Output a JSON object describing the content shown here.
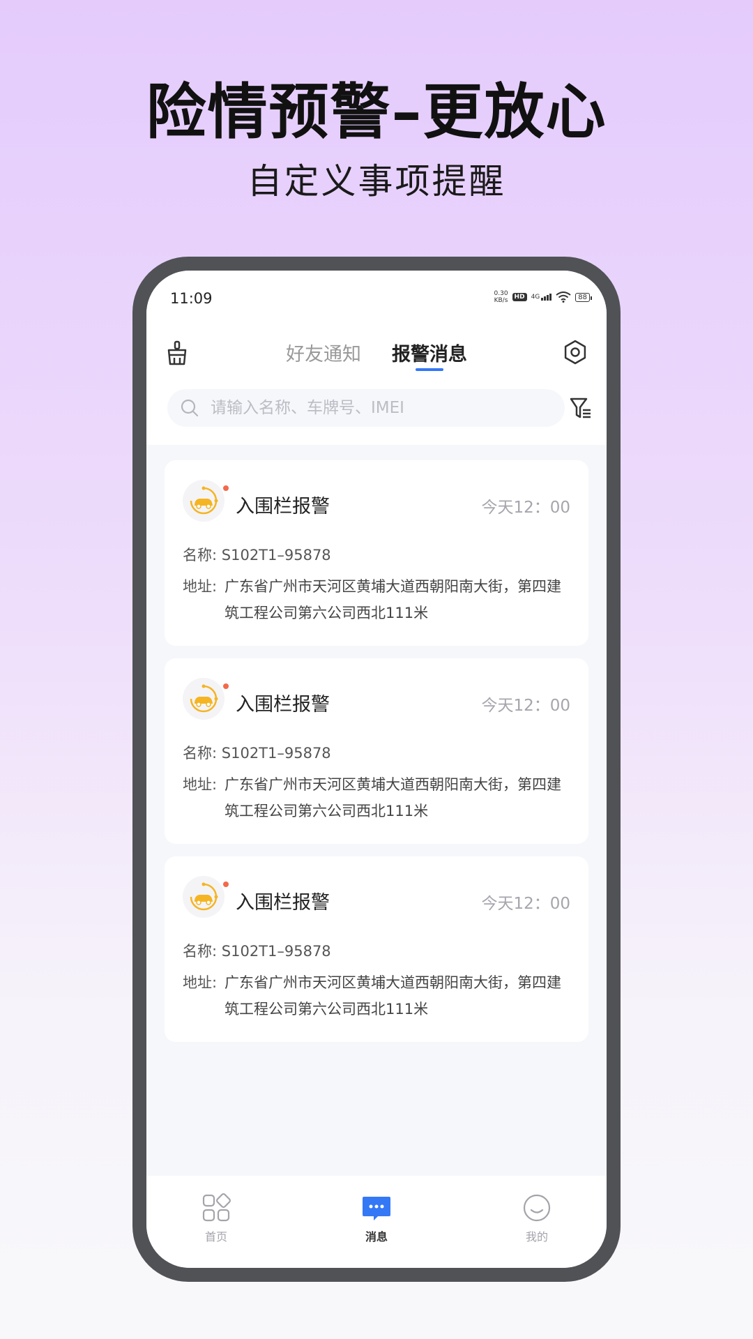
{
  "hero": {
    "title": "险情预警–更放心",
    "subtitle": "自定义事项提醒"
  },
  "status_bar": {
    "time": "11:09",
    "speed_value": "0.30",
    "speed_unit": "KB/s",
    "hd": "HD",
    "network": "4G",
    "battery": "88"
  },
  "header": {
    "tabs": [
      {
        "label": "好友通知",
        "active": false
      },
      {
        "label": "报警消息",
        "active": true
      }
    ],
    "accent_color": "#3478f6"
  },
  "search": {
    "placeholder": "请输入名称、车牌号、IMEI",
    "value": ""
  },
  "alerts": [
    {
      "title": "入围栏报警",
      "time": "今天12：00",
      "name_label": "名称:",
      "name": "S102T1–95878",
      "address_label": "地址:",
      "address": "广东省广州市天河区黄埔大道西朝阳南大街，第四建筑工程公司第六公司西北111米"
    },
    {
      "title": "入围栏报警",
      "time": "今天12：00",
      "name_label": "名称:",
      "name": "S102T1–95878",
      "address_label": "地址:",
      "address": "广东省广州市天河区黄埔大道西朝阳南大街，第四建筑工程公司第六公司西北111米"
    },
    {
      "title": "入围栏报警",
      "time": "今天12：00",
      "name_label": "名称:",
      "name": "S102T1–95878",
      "address_label": "地址:",
      "address": "广东省广州市天河区黄埔大道西朝阳南大街，第四建筑工程公司第六公司西北111米"
    }
  ],
  "bottom_nav": [
    {
      "label": "首页",
      "icon": "grid-icon",
      "active": false
    },
    {
      "label": "消息",
      "icon": "message-icon",
      "active": true
    },
    {
      "label": "我的",
      "icon": "smile-icon",
      "active": false
    }
  ]
}
